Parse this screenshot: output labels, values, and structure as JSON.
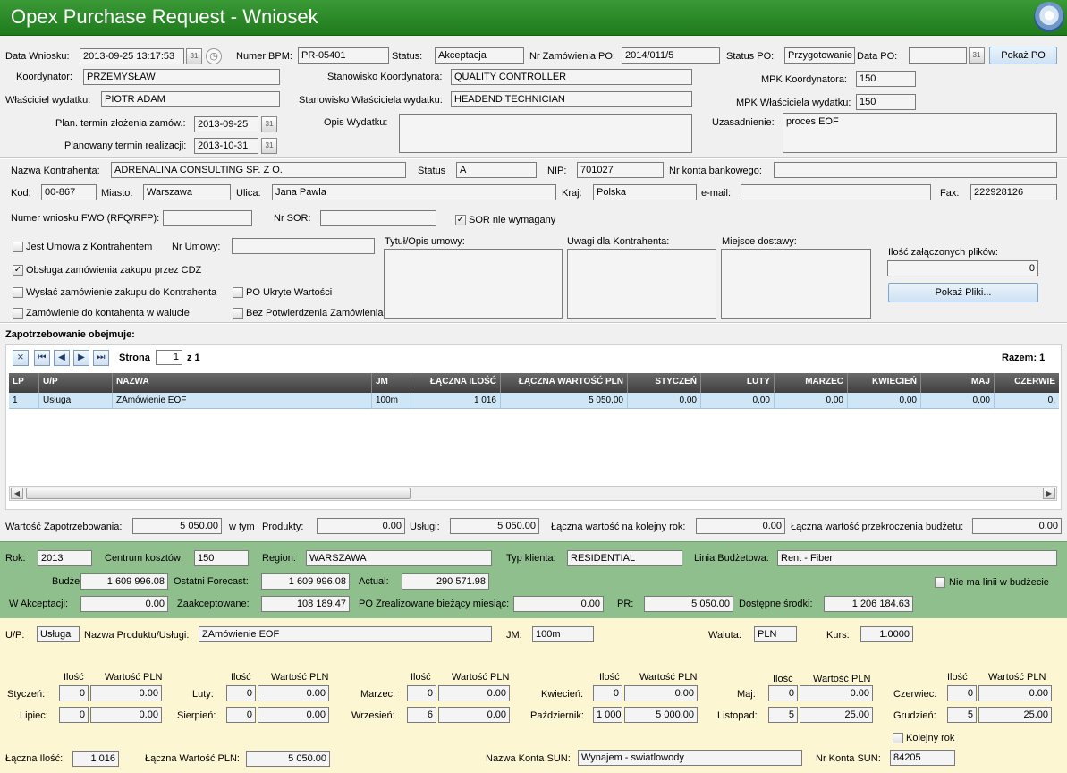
{
  "app": {
    "title": "Opex Purchase Request - Wniosek"
  },
  "colors": {
    "title_bg": "#2e8b2b",
    "green_panel": "#8fbf8c",
    "yellow_panel": "#fdf6d2",
    "grid_header": "#4d4d4d",
    "selected_row": "#cfe6f7"
  },
  "header": {
    "data_wniosku_label": "Data Wniosku:",
    "data_wniosku": "2013-09-25 13:17:53",
    "numer_bpm_label": "Numer BPM:",
    "numer_bpm": "PR-05401",
    "status_label": "Status:",
    "status": "Akceptacja",
    "nr_zamowienia_label": "Nr Zamówienia PO:",
    "nr_zamowienia": "2014/011/5",
    "status_po_label": "Status PO:",
    "status_po": "Przygotowanie",
    "data_po_label": "Data PO:",
    "data_po": "",
    "pokaz_po": "Pokaż PO",
    "koordynator_label": "Koordynator:",
    "koordynator": "PRZEMYSŁAW",
    "stan_koord_label": "Stanowisko Koordynatora:",
    "stan_koord": "QUALITY CONTROLLER",
    "mpk_koord_label": "MPK Koordynatora:",
    "mpk_koord": "150",
    "wlasciciel_label": "Właściciel wydatku:",
    "wlasciciel": "PIOTR ADAM",
    "stan_wlasc_label": "Stanowisko Właściciela wydatku:",
    "stan_wlasc": "HEADEND TECHNICIAN",
    "mpk_wlasc_label": "MPK Właściciela wydatku:",
    "mpk_wlasc": "150",
    "plan_termin_label": "Plan. termin złożenia zamów.:",
    "plan_termin": "2013-09-25",
    "plan_realiz_label": "Planowany termin realizacji:",
    "plan_realiz": "2013-10-31",
    "opis_label": "Opis Wydatku:",
    "opis": "",
    "uzasadnienie_label": "Uzasadnienie:",
    "uzasadnienie": "proces EOF"
  },
  "contractor": {
    "nazwa_label": "Nazwa Kontrahenta:",
    "nazwa": "ADRENALINA CONSULTING SP. Z O.",
    "status_label": "Status",
    "status": "A",
    "nip_label": "NIP:",
    "nip": "701027",
    "konto_label": "Nr konta bankowego:",
    "konto": "",
    "kod_label": "Kod:",
    "kod": "00-867",
    "miasto_label": "Miasto:",
    "miasto": "Warszawa",
    "ulica_label": "Ulica:",
    "ulica": "Jana Pawla",
    "kraj_label": "Kraj:",
    "kraj": "Polska",
    "email_label": "e-mail:",
    "email": "",
    "fax_label": "Fax:",
    "fax": "222928126",
    "fwo_label": "Numer wniosku FWO (RFQ/RFP):",
    "fwo": "",
    "sor_label": "Nr SOR:",
    "sor": "",
    "sor_nie_label": "SOR nie wymagany",
    "umowa_label": "Jest Umowa z Kontrahentem",
    "nr_umowy_label": "Nr Umowy:",
    "nr_umowy": "",
    "cdz_label": "Obsługa zamówienia zakupu przez CDZ",
    "wyslac_label": "Wysłać zamówienie zakupu do Kontrahenta",
    "ukryte_label": "PO Ukryte Wartości",
    "waluta_label": "Zamówienie do kontahenta w walucie",
    "bez_potw_label": "Bez Potwierdzenia Zamówienia",
    "tytul_label": "Tytuł/Opis umowy:",
    "uwagi_label": "Uwagi dla Kontrahenta:",
    "miejsce_label": "Miejsce dostawy:",
    "ilosc_plikow_label": "Ilość załączonych plików:",
    "ilosc_plikow": "0",
    "pokaz_pliki": "Pokaż Pliki..."
  },
  "grid": {
    "section_title": "Zapotrzebowanie obejmuje:",
    "strona_label": "Strona",
    "strona": "1",
    "z_label": "z 1",
    "razem": "Razem: 1",
    "columns": [
      "LP",
      "U/P",
      "NAZWA",
      "JM",
      "ŁĄCZNA ILOŚĆ",
      "ŁĄCZNA WARTOŚĆ PLN",
      "STYCZEŃ",
      "LUTY",
      "MARZEC",
      "KWIECIEŃ",
      "MAJ",
      "CZERWIE"
    ],
    "rows": [
      [
        "1",
        "Usługa",
        "ZAmówienie EOF",
        "100m",
        "1 016",
        "5 050,00",
        "0,00",
        "0,00",
        "0,00",
        "0,00",
        "0,00",
        "0,"
      ]
    ]
  },
  "totals": {
    "wartosc_label": "Wartość Zapotrzebowania:",
    "wartosc": "5 050.00",
    "wtym_label": "w tym",
    "produkty_label": "Produkty:",
    "produkty": "0.00",
    "uslugi_label": "Usługi:",
    "uslugi": "5 050.00",
    "kolejny_label": "Łączna wartość na kolejny rok:",
    "kolejny": "0.00",
    "przekroczenie_label": "Łączna wartość przekroczenia budżetu:",
    "przekroczenie": "0.00"
  },
  "budget": {
    "rok_label": "Rok:",
    "rok": "2013",
    "centrum_label": "Centrum kosztów:",
    "centrum": "150",
    "region_label": "Region:",
    "region": "WARSZAWA",
    "typ_label": "Typ klienta:",
    "typ": "RESIDENTIAL",
    "linia_label": "Linia Budżetowa:",
    "linia": "Rent - Fiber",
    "budzet_label": "Budżet:",
    "budzet": "1 609 996.08",
    "forecast_label": "Ostatni Forecast:",
    "forecast": "1 609 996.08",
    "actual_label": "Actual:",
    "actual": "290 571.98",
    "nie_ma_label": "Nie ma linii w budżecie",
    "w_akcept_label": "W Akceptacji:",
    "w_akcept": "0.00",
    "zaakcept_label": "Zaakceptowane:",
    "zaakcept": "108 189.47",
    "po_zreal_label": "PO Zrealizowane bieżący miesiąc:",
    "po_zreal": "0.00",
    "pr_label": "PR:",
    "pr": "5 050.00",
    "dostepne_label": "Dostępne środki:",
    "dostepne": "1 206 184.63"
  },
  "detail": {
    "up_label": "U/P:",
    "up": "Usługa",
    "nazwa_label": "Nazwa Produktu/Usługi:",
    "nazwa": "ZAmówienie EOF",
    "jm_label": "JM:",
    "jm": "100m",
    "waluta_label": "Waluta:",
    "waluta": "PLN",
    "kurs_label": "Kurs:",
    "kurs": "1.0000",
    "ilosc_h": "Ilość",
    "wartosc_h": "Wartość PLN",
    "months": [
      {
        "label": "Styczeń:",
        "qty": "0",
        "val": "0.00"
      },
      {
        "label": "Luty:",
        "qty": "0",
        "val": "0.00"
      },
      {
        "label": "Marzec:",
        "qty": "0",
        "val": "0.00"
      },
      {
        "label": "Kwiecień:",
        "qty": "0",
        "val": "0.00"
      },
      {
        "label": "Maj:",
        "qty": "0",
        "val": "0.00"
      },
      {
        "label": "Czerwiec:",
        "qty": "0",
        "val": "0.00"
      },
      {
        "label": "Lipiec:",
        "qty": "0",
        "val": "0.00"
      },
      {
        "label": "Sierpień:",
        "qty": "0",
        "val": "0.00"
      },
      {
        "label": "Wrzesień:",
        "qty": "6",
        "val": "0.00"
      },
      {
        "label": "Październik:",
        "qty": "1 000",
        "val": "5 000.00"
      },
      {
        "label": "Listopad:",
        "qty": "5",
        "val": "25.00"
      },
      {
        "label": "Grudzień:",
        "qty": "5",
        "val": "25.00"
      }
    ],
    "kolejny_rok_label": "Kolejny rok",
    "laczna_ilosc_label": "Łączna Ilość:",
    "laczna_ilosc": "1 016",
    "laczna_wartosc_label": "Łączna Wartość PLN:",
    "laczna_wartosc": "5 050.00",
    "konto_sun_label": "Nazwa Konta SUN:",
    "konto_sun": "Wynajem - swiatlowody",
    "nr_konta_sun_label": "Nr Konta SUN:",
    "nr_konta_sun": "84205"
  }
}
